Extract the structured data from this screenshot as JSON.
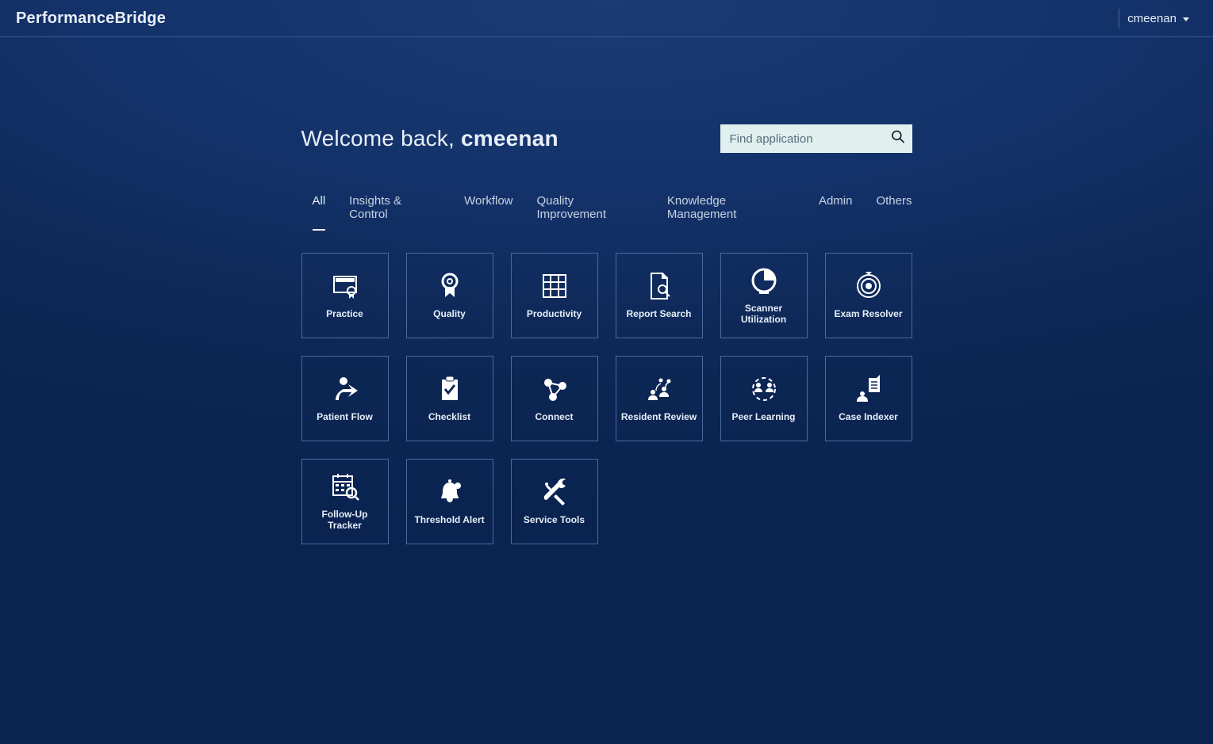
{
  "header": {
    "brand": "PerformanceBridge",
    "user": "cmeenan"
  },
  "welcome": {
    "prefix": "Welcome back, ",
    "username": "cmeenan"
  },
  "search": {
    "placeholder": "Find application",
    "value": ""
  },
  "tabs": [
    {
      "id": "all",
      "label": "All",
      "active": true
    },
    {
      "id": "insights",
      "label": "Insights & Control",
      "active": false
    },
    {
      "id": "workflow",
      "label": "Workflow",
      "active": false
    },
    {
      "id": "quality",
      "label": "Quality Improvement",
      "active": false
    },
    {
      "id": "knowledge",
      "label": "Knowledge Management",
      "active": false
    },
    {
      "id": "admin",
      "label": "Admin",
      "active": false
    },
    {
      "id": "others",
      "label": "Others",
      "active": false
    }
  ],
  "tiles": [
    {
      "id": "practice",
      "label": "Practice",
      "icon": "certificate-icon"
    },
    {
      "id": "quality-app",
      "label": "Quality",
      "icon": "ribbon-icon"
    },
    {
      "id": "productivity",
      "label": "Productivity",
      "icon": "calendar-grid-icon"
    },
    {
      "id": "report-search",
      "label": "Report Search",
      "icon": "file-search-icon"
    },
    {
      "id": "scanner-util",
      "label": "Scanner Utilization",
      "icon": "gauge-icon"
    },
    {
      "id": "exam-resolver",
      "label": "Exam Resolver",
      "icon": "target-icon"
    },
    {
      "id": "patient-flow",
      "label": "Patient Flow",
      "icon": "flow-person-icon"
    },
    {
      "id": "checklist",
      "label": "Checklist",
      "icon": "clipboard-check-icon"
    },
    {
      "id": "connect",
      "label": "Connect",
      "icon": "network-icon"
    },
    {
      "id": "resident-review",
      "label": "Resident Review",
      "icon": "people-review-icon"
    },
    {
      "id": "peer-learning",
      "label": "Peer Learning",
      "icon": "people-circle-icon"
    },
    {
      "id": "case-indexer",
      "label": "Case Indexer",
      "icon": "index-flag-icon"
    },
    {
      "id": "followup",
      "label": "Follow-Up Tracker",
      "icon": "calendar-search-icon"
    },
    {
      "id": "threshold",
      "label": "Threshold Alert",
      "icon": "bell-alert-icon"
    },
    {
      "id": "service-tools",
      "label": "Service Tools",
      "icon": "tools-icon"
    }
  ],
  "colors": {
    "background": "#0f2a5a",
    "tileBorder": "#4a6a9e",
    "searchBg": "#e0f0ef",
    "text": "#e7eef7"
  }
}
